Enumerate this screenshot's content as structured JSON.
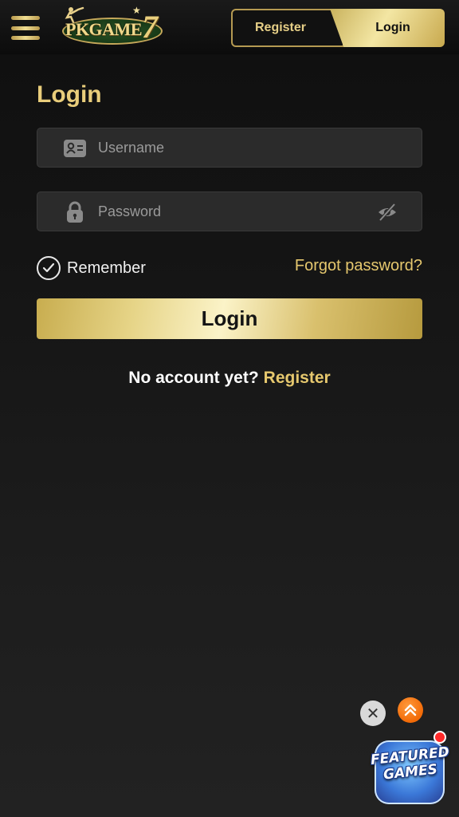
{
  "header": {
    "logo_text": "PKGAME",
    "logo_number": "7",
    "register_tab": "Register",
    "login_tab": "Login"
  },
  "main": {
    "title": "Login",
    "username_placeholder": "Username",
    "password_placeholder": "Password",
    "remember_label": "Remember",
    "forgot_label": "Forgot password?",
    "login_button": "Login",
    "no_account_text": "No account yet?",
    "register_link": "Register"
  },
  "floating": {
    "close_glyph": "✕",
    "featured_line1": "FEATURED",
    "featured_line2": "GAMES"
  },
  "colors": {
    "accent_gold": "#e9cd7b",
    "background": "#1a1a1a",
    "field_bg": "#2b2b2b",
    "top_button": "#f26a07"
  },
  "icons": {
    "menu": "hamburger-icon",
    "username": "id-card-icon",
    "password": "lock-icon",
    "visibility": "eye-slash-icon",
    "remember": "check-circle-icon",
    "back_to_top": "double-chevron-up-icon",
    "close": "close-icon"
  }
}
